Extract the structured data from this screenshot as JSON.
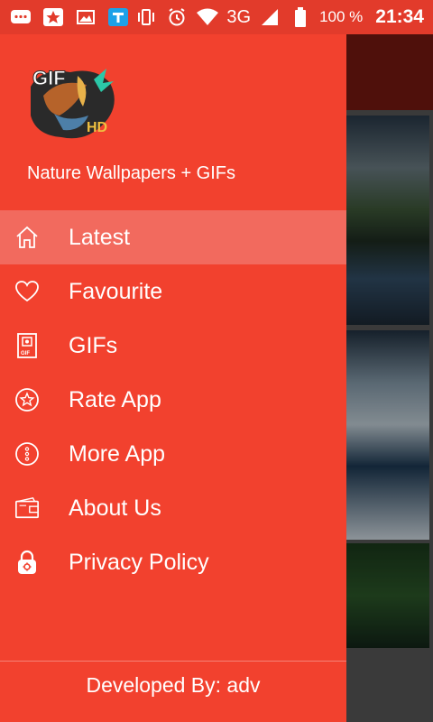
{
  "status_bar": {
    "network": "3G",
    "battery": "100 %",
    "time": "21:34",
    "icons": [
      "message-icon",
      "star-app-icon",
      "gallery-icon",
      "tasks-app-icon",
      "vibrate-icon",
      "alarm-icon",
      "wifi-icon",
      "signal-icon",
      "battery-icon"
    ]
  },
  "drawer": {
    "app_name": "Nature Wallpapers + GIFs",
    "logo": {
      "text_gif": "GIF",
      "text_hd": "HD"
    },
    "items": [
      {
        "label": "Latest",
        "icon": "home-icon",
        "active": true
      },
      {
        "label": "Favourite",
        "icon": "heart-icon",
        "active": false
      },
      {
        "label": "GIFs",
        "icon": "gif-file-icon",
        "active": false
      },
      {
        "label": "Rate App",
        "icon": "star-circle-icon",
        "active": false
      },
      {
        "label": "More App",
        "icon": "more-circle-icon",
        "active": false
      },
      {
        "label": "About Us",
        "icon": "wallet-icon",
        "active": false
      },
      {
        "label": "Privacy Policy",
        "icon": "lock-icon",
        "active": false
      }
    ],
    "footer": "Developed By: adv"
  },
  "colors": {
    "drawer": "#f2412e",
    "active_item": "#f26a5e",
    "status_bar": "#e23b2b"
  }
}
